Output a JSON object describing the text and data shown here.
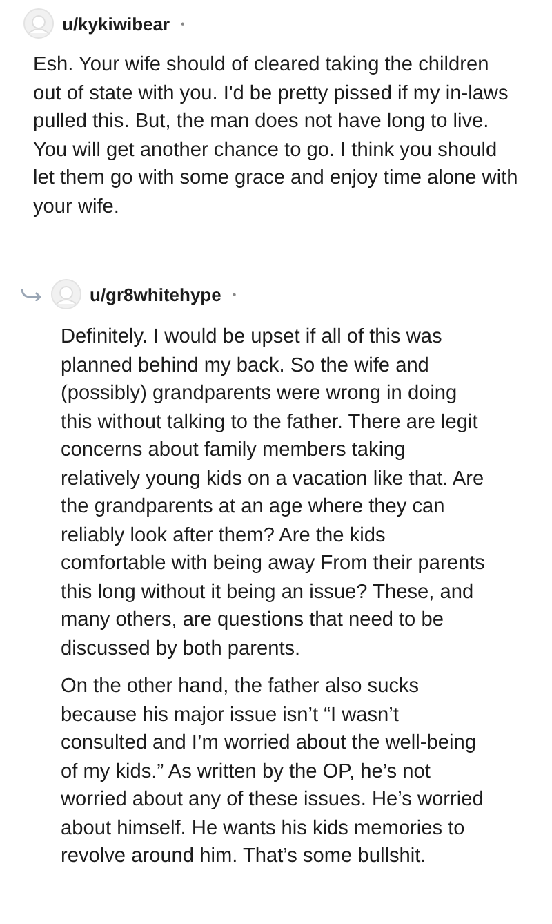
{
  "comments": [
    {
      "author": "u/kykiwibear",
      "separator": "•",
      "paragraphs": [
        "Esh. Your wife should of cleared taking the children out of state with you. I'd be pretty pissed if my in-laws pulled this. But, the man does not have long to live. You will get another chance to go. I think you should let them go with some grace and enjoy time alone with your wife."
      ],
      "replies": [
        {
          "author": "u/gr8whitehype",
          "separator": "•",
          "paragraphs": [
            "Definitely. I would be upset if all of this was planned behind my back. So the wife and (possibly) grandparents were wrong in doing this without talking to the father. There are legit concerns about family members taking relatively young kids on a vacation like that. Are the grandparents at an age where they can reliably look after them? Are the kids comfortable with being away From their parents this long without it being an issue? These, and many others, are questions that need to be discussed by both parents.",
            "On the other hand, the father also sucks because his major issue isn’t “I wasn’t consulted and I’m worried about the well-being of my kids.” As written by the OP, he’s not worried about any of these issues. He’s worried about himself. He wants his kids memories to revolve around him. That’s some bullshit."
          ]
        }
      ]
    }
  ]
}
